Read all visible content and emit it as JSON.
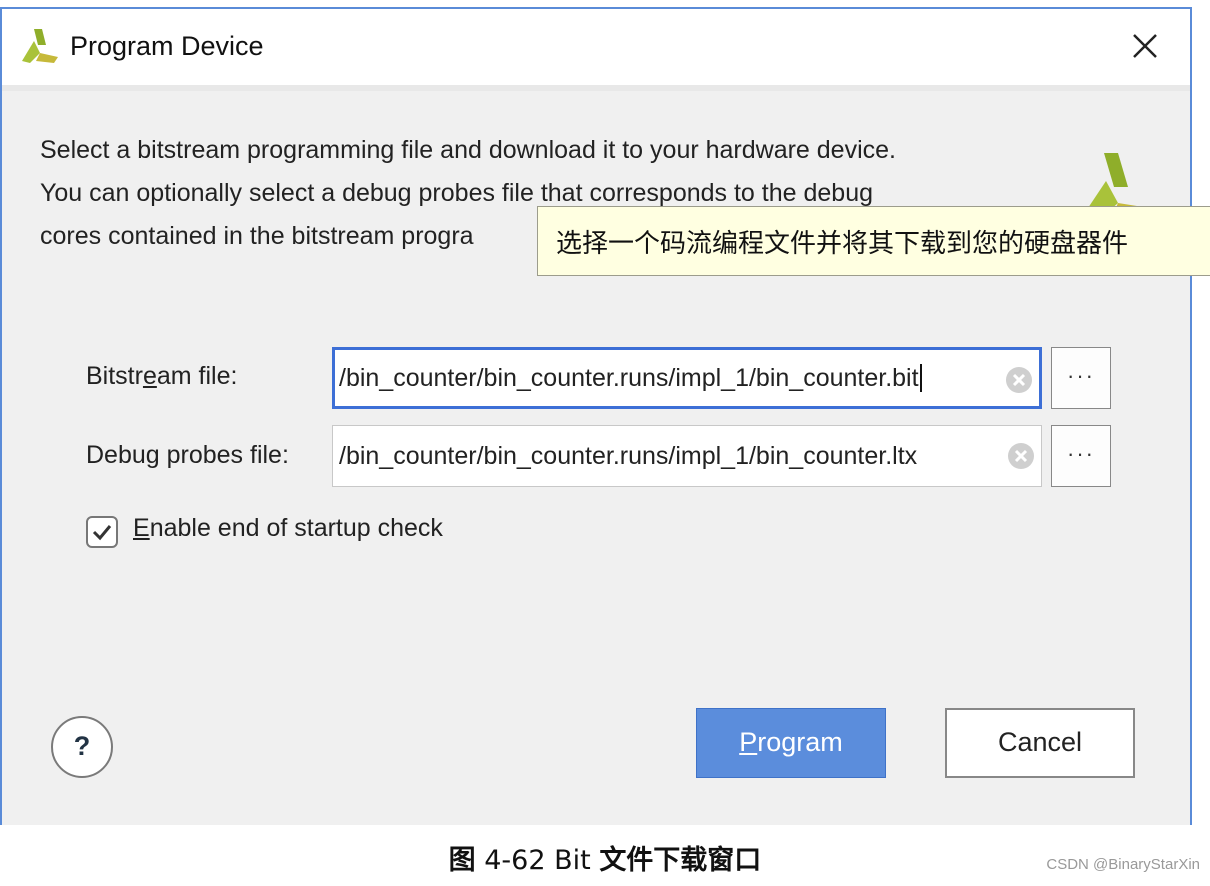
{
  "dialog": {
    "title": "Program Device",
    "description": [
      "Select a bitstream programming file and download it to your hardware device.",
      "You can optionally select a debug probes file that corresponds to the debug",
      "cores contained in the bitstream progra"
    ],
    "tooltip": "选择一个码流编程文件并将其下载到您的硬盘器件"
  },
  "bitstream": {
    "label_pre": "Bitstr",
    "label_ul": "e",
    "label_post": "am file:",
    "value": "/bin_counter/bin_counter.runs/impl_1/bin_counter.bit",
    "browse_label": "···"
  },
  "probes": {
    "label_pre": "Debu",
    "label_ul": "g",
    "label_post": " probes file:",
    "value": "/bin_counter/bin_counter.runs/impl_1/bin_counter.ltx",
    "browse_label": "···"
  },
  "startup_check": {
    "label_ul": "E",
    "label_post": "nable end of startup check",
    "checked": true
  },
  "buttons": {
    "help_label": "?",
    "program_ul": "P",
    "program_post": "rogram",
    "cancel_label": "Cancel"
  },
  "caption": {
    "prefix": "图",
    "number": " 4-62 Bit ",
    "text": "文件下载窗口"
  },
  "watermark": "CSDN @BinaryStarXin"
}
